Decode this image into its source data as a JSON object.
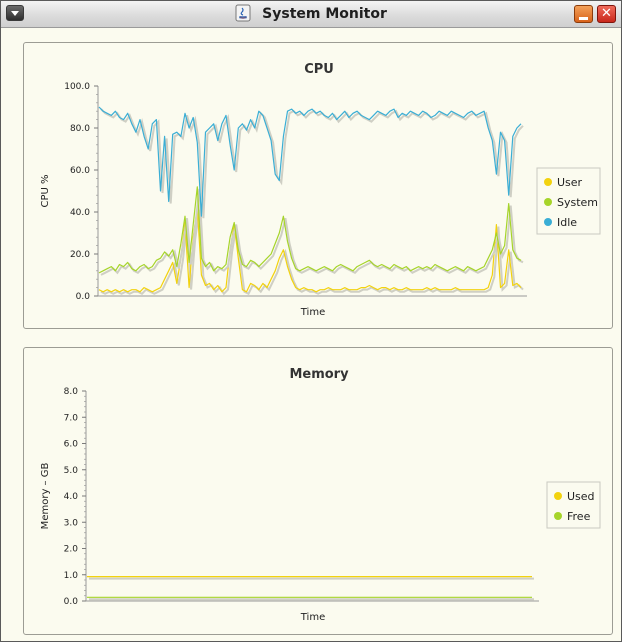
{
  "window": {
    "title": "System Monitor",
    "close_glyph": "✕"
  },
  "icons": {
    "window_menu": "chevron-down-icon",
    "app": "java-icon",
    "minimize": "minimize-icon",
    "close": "close-icon"
  },
  "colors": {
    "user": "#f2d20e",
    "system": "#a6d42a",
    "idle": "#3aaed5",
    "used": "#f2d20e",
    "free": "#a6d42a",
    "background": "#fbfbef"
  },
  "cpu": {
    "title": "CPU",
    "ylabel": "CPU %",
    "xlabel": "Time",
    "yticks": [
      "100.0",
      "80.0",
      "60.0",
      "40.0",
      "20.0",
      "0.0"
    ],
    "legend": [
      "User",
      "System",
      "Idle"
    ]
  },
  "memory": {
    "title": "Memory",
    "ylabel": "Memory – GB",
    "xlabel": "Time",
    "yticks": [
      "8.0",
      "7.0",
      "6.0",
      "5.0",
      "4.0",
      "3.0",
      "2.0",
      "1.0",
      "0.0"
    ],
    "legend": [
      "Used",
      "Free"
    ]
  },
  "chart_data": [
    {
      "type": "line",
      "title": "CPU",
      "xlabel": "Time",
      "ylabel": "CPU %",
      "ylim": [
        0,
        100
      ],
      "grid": false,
      "legend_position": "right",
      "series": [
        {
          "name": "User",
          "values": [
            3,
            2,
            3,
            2,
            3,
            2,
            3,
            2,
            3,
            3,
            2,
            4,
            3,
            2,
            3,
            4,
            8,
            12,
            16,
            6,
            18,
            35,
            4,
            28,
            42,
            10,
            5,
            6,
            3,
            5,
            2,
            4,
            22,
            34,
            18,
            3,
            2,
            6,
            5,
            3,
            6,
            4,
            8,
            12,
            18,
            22,
            14,
            8,
            4,
            3,
            4,
            3,
            3,
            2,
            3,
            3,
            4,
            3,
            3,
            3,
            4,
            3,
            3,
            3,
            4,
            4,
            5,
            4,
            3,
            4,
            4,
            3,
            4,
            3,
            3,
            4,
            3,
            3,
            3,
            3,
            4,
            3,
            4,
            3,
            3,
            3,
            3,
            4,
            3,
            3,
            3,
            3,
            3,
            3,
            3,
            4,
            10,
            34,
            4,
            6,
            22,
            5,
            6,
            4
          ]
        },
        {
          "name": "System",
          "values": [
            11,
            12,
            13,
            14,
            12,
            15,
            14,
            16,
            13,
            12,
            14,
            15,
            13,
            14,
            17,
            18,
            21,
            19,
            22,
            14,
            25,
            38,
            16,
            34,
            52,
            18,
            14,
            16,
            12,
            14,
            13,
            15,
            28,
            35,
            22,
            15,
            14,
            17,
            16,
            14,
            16,
            18,
            20,
            25,
            30,
            38,
            26,
            18,
            13,
            12,
            13,
            14,
            13,
            12,
            13,
            14,
            13,
            12,
            14,
            15,
            14,
            13,
            12,
            14,
            15,
            16,
            17,
            15,
            14,
            15,
            14,
            13,
            15,
            14,
            13,
            14,
            12,
            13,
            14,
            13,
            14,
            13,
            15,
            14,
            13,
            12,
            13,
            14,
            13,
            12,
            14,
            13,
            12,
            13,
            14,
            18,
            22,
            30,
            20,
            24,
            44,
            22,
            18,
            17
          ]
        },
        {
          "name": "Idle",
          "values": [
            90,
            88,
            87,
            86,
            88,
            85,
            84,
            87,
            82,
            78,
            84,
            76,
            70,
            82,
            84,
            50,
            76,
            45,
            77,
            78,
            76,
            87,
            80,
            85,
            73,
            38,
            78,
            80,
            82,
            74,
            82,
            86,
            72,
            60,
            80,
            82,
            79,
            84,
            80,
            88,
            86,
            80,
            74,
            58,
            55,
            76,
            88,
            89,
            87,
            88,
            86,
            88,
            89,
            87,
            88,
            86,
            85,
            87,
            84,
            86,
            88,
            85,
            87,
            88,
            86,
            85,
            84,
            86,
            88,
            87,
            86,
            88,
            89,
            85,
            87,
            86,
            88,
            87,
            86,
            88,
            87,
            85,
            86,
            88,
            87,
            86,
            88,
            87,
            86,
            85,
            87,
            88,
            86,
            87,
            88,
            80,
            74,
            58,
            78,
            74,
            48,
            76,
            80,
            82
          ]
        }
      ]
    },
    {
      "type": "line",
      "title": "Memory",
      "xlabel": "Time",
      "ylabel": "Memory – GB",
      "ylim": [
        0,
        8
      ],
      "grid": false,
      "legend_position": "right",
      "series": [
        {
          "name": "Used",
          "values": [
            0.93,
            0.93,
            0.93,
            0.93,
            0.93,
            0.93,
            0.93,
            0.93,
            0.93,
            0.93,
            0.93,
            0.93,
            0.93,
            0.93,
            0.93,
            0.93,
            0.93,
            0.93,
            0.93,
            0.93,
            0.93,
            0.93,
            0.93,
            0.93,
            0.93,
            0.93,
            0.93,
            0.93,
            0.93,
            0.93,
            0.93,
            0.93,
            0.93,
            0.93,
            0.93,
            0.93,
            0.93,
            0.93,
            0.93,
            0.93,
            0.93,
            0.93,
            0.93,
            0.93,
            0.93,
            0.93,
            0.93,
            0.93,
            0.93,
            0.93,
            0.93,
            0.93,
            0.93,
            0.93,
            0.93,
            0.93,
            0.93,
            0.93,
            0.93,
            0.93,
            0.93,
            0.93,
            0.93,
            0.93,
            0.93,
            0.93,
            0.93,
            0.93,
            0.93,
            0.93,
            0.93,
            0.93,
            0.93,
            0.93,
            0.93,
            0.93,
            0.93,
            0.93,
            0.93,
            0.93,
            0.93,
            0.93,
            0.93,
            0.93,
            0.93,
            0.93,
            0.93,
            0.93,
            0.93,
            0.93,
            0.93,
            0.93,
            0.93,
            0.93,
            0.93,
            0.93,
            0.93,
            0.93,
            0.93,
            0.93,
            0.93,
            0.93,
            0.93,
            0.93
          ]
        },
        {
          "name": "Free",
          "values": [
            0.14,
            0.14,
            0.14,
            0.14,
            0.14,
            0.14,
            0.14,
            0.14,
            0.14,
            0.14,
            0.14,
            0.14,
            0.14,
            0.14,
            0.14,
            0.14,
            0.14,
            0.14,
            0.14,
            0.14,
            0.14,
            0.14,
            0.14,
            0.14,
            0.14,
            0.14,
            0.14,
            0.14,
            0.14,
            0.14,
            0.14,
            0.14,
            0.14,
            0.14,
            0.14,
            0.14,
            0.14,
            0.14,
            0.14,
            0.14,
            0.14,
            0.14,
            0.14,
            0.14,
            0.14,
            0.14,
            0.14,
            0.14,
            0.14,
            0.14,
            0.14,
            0.14,
            0.14,
            0.14,
            0.14,
            0.14,
            0.14,
            0.14,
            0.14,
            0.14,
            0.14,
            0.14,
            0.14,
            0.14,
            0.14,
            0.14,
            0.14,
            0.14,
            0.14,
            0.14,
            0.14,
            0.14,
            0.14,
            0.14,
            0.14,
            0.14,
            0.14,
            0.14,
            0.14,
            0.14,
            0.14,
            0.14,
            0.14,
            0.14,
            0.14,
            0.14,
            0.14,
            0.14,
            0.14,
            0.14,
            0.14,
            0.14,
            0.14,
            0.14,
            0.14,
            0.14,
            0.14,
            0.14,
            0.14,
            0.14,
            0.14,
            0.14,
            0.14,
            0.14
          ]
        }
      ]
    }
  ]
}
